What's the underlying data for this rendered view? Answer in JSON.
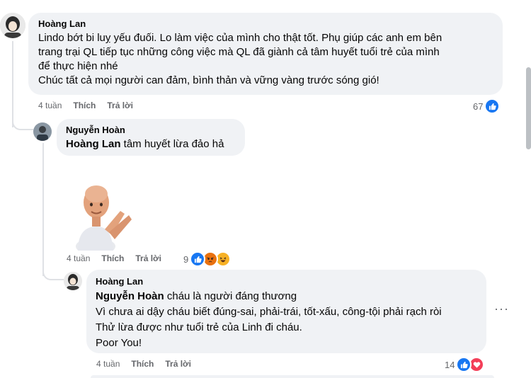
{
  "comments": [
    {
      "author": "Hoàng Lan",
      "lines": [
        "Lindo bớt bi luỵ yếu đuối. Lo làm việc của mình cho thật tốt. Phụ giúp các anh em bên",
        "trang trại QL tiếp tục những công việc mà QL đã giành cả tâm huyết tuổi trẻ của mình",
        "để thực hiện nhé",
        "Chúc tất cả mọi người can đảm, bình thản và vững vàng trước sóng gió!"
      ],
      "time": "4 tuần",
      "like_label": "Thích",
      "reply_label": "Trả lời",
      "reaction_count": "67"
    },
    {
      "author": "Nguyễn Hoàn",
      "mention": "Hoàng Lan",
      "text": " tâm huyết lừa đảo hả",
      "sticker": "clapping-man-sticker",
      "time": "4 tuần",
      "like_label": "Thích",
      "reply_label": "Trả lời",
      "reaction_count": "9"
    },
    {
      "author": "Hoàng Lan",
      "mention": "Nguyễn Hoàn",
      "first_line_rest": " cháu là người đáng thương",
      "lines": [
        "Vì chưa ai dậy cháu biết đúng-sai, phải-trái, tốt-xấu, công-tội phải rạch ròi",
        "Thử lừa được như tuổi trẻ của Linh đi cháu.",
        "Poor You!"
      ],
      "time": "4 tuần",
      "like_label": "Thích",
      "reply_label": "Trả lời",
      "reaction_count": "14"
    }
  ],
  "more_label": "···",
  "colors": {
    "like_blue": "#1877f2",
    "angry": "#e9710f",
    "haha": "#f7b125",
    "love": "#f33e58"
  }
}
